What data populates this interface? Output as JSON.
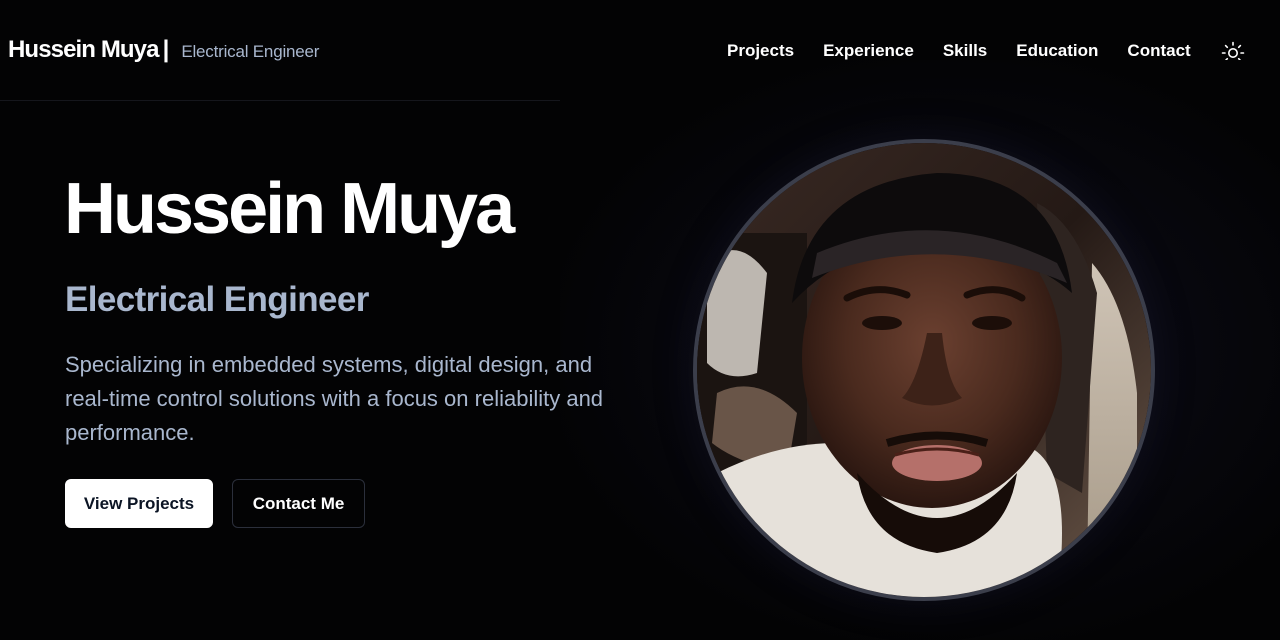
{
  "header": {
    "brand_name": "Hussein Muya",
    "separator": "|",
    "brand_role": "Electrical Engineer",
    "nav": [
      {
        "label": "Projects"
      },
      {
        "label": "Experience"
      },
      {
        "label": "Skills"
      },
      {
        "label": "Education"
      },
      {
        "label": "Contact"
      }
    ],
    "theme_toggle_icon": "sun-icon"
  },
  "hero": {
    "title": "Hussein Muya",
    "subtitle": "Electrical Engineer",
    "description": "Specializing in embedded systems, digital design, and real-time control solutions with a focus on reliability and performance.",
    "primary_button": "View Projects",
    "secondary_button": "Contact Me",
    "profile_photo": "profile-photo"
  },
  "colors": {
    "background": "#030304",
    "muted_text": "#a9b7ce",
    "primary_button_bg": "#ffffff",
    "secondary_button_border": "#2b2f3b"
  }
}
